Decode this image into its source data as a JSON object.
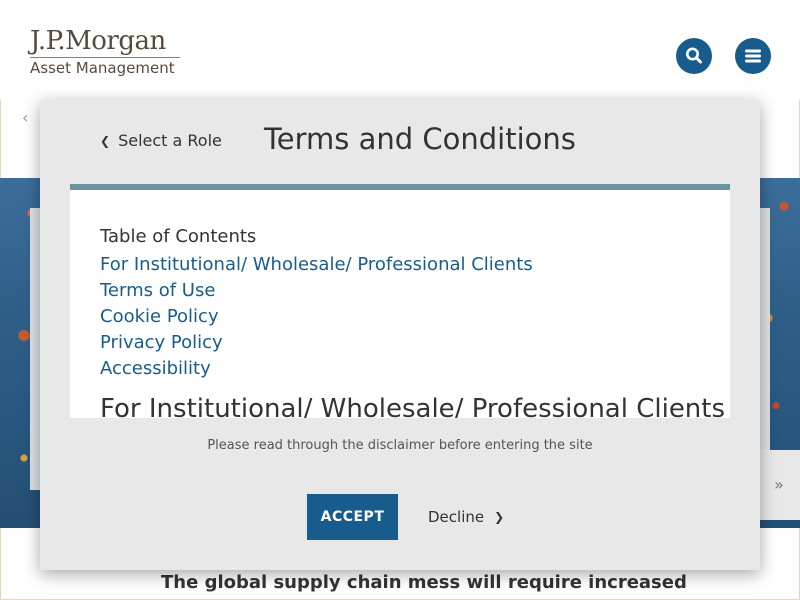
{
  "brand": {
    "name": "J.P.Morgan",
    "sub": "Asset Management"
  },
  "header": {
    "search_icon": "search-icon",
    "menu_icon": "hamburger-menu-icon"
  },
  "page": {
    "back_chevron": "‹",
    "hero_arrow": "»",
    "headline": "The global supply chain mess will require increased"
  },
  "modal": {
    "back_link": "Select a Role",
    "title": "Terms and Conditions",
    "toc_heading": "Table of Contents",
    "toc_items": [
      "For Institutional/ Wholesale/ Professional Clients",
      "Terms of Use",
      "Cookie Policy",
      "Privacy Policy",
      "Accessibility"
    ],
    "section_heading": "For Institutional/ Wholesale/ Professional Clients",
    "disclaimer": "Please read through the disclaimer before entering the site",
    "accept_label": "ACCEPT",
    "decline_label": "Decline"
  },
  "colors": {
    "brand_blue": "#175c8c",
    "rule_teal": "#6b959e",
    "logo_brown": "#5b4a3c"
  }
}
